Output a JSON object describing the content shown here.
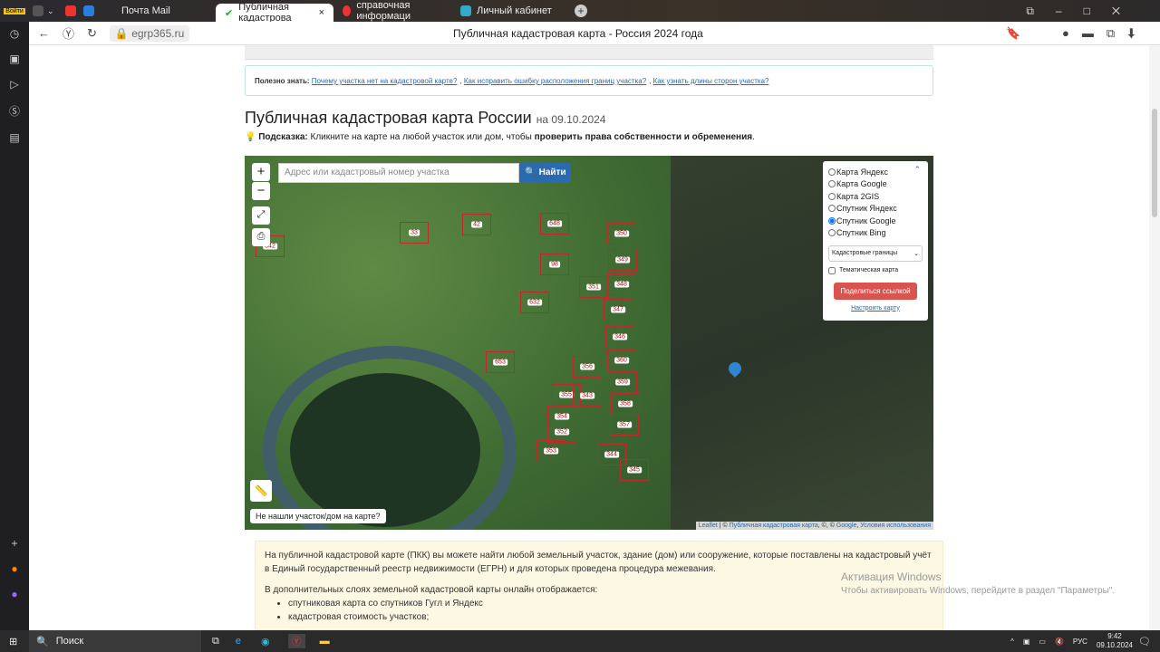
{
  "browser": {
    "login_label": "Войти",
    "tabs": [
      {
        "label": "Почта Mail",
        "active": false
      },
      {
        "label": "Публичная кадастрова",
        "active": true
      },
      {
        "label": "справочная информаци",
        "active": false
      },
      {
        "label": "Личный кабинет",
        "active": false
      }
    ],
    "url": "egrp365.ru",
    "page_title": "Публичная кадастровая карта - Россия 2024 года"
  },
  "hint": {
    "prefix": "Полезно знать:",
    "links": [
      "Почему участка нет на кадастровой карте?",
      "Как исправить ошибку расположения границ участка?",
      "Как узнать длины сторон участка?"
    ]
  },
  "heading": {
    "title": "Публичная кадастровая карта России",
    "date": "на 09.10.2024"
  },
  "tip": {
    "label": "Подсказка:",
    "text": "Кликните на карте на любой участок или дом, чтобы",
    "bold": "проверить права собственности и обременения",
    "end": "."
  },
  "map": {
    "search_placeholder": "Адрес или кадастровый номер участка",
    "find_label": "Найти",
    "layers": [
      {
        "label": "Карта Яндекс",
        "checked": false
      },
      {
        "label": "Карта Google",
        "checked": false
      },
      {
        "label": "Карта 2GIS",
        "checked": false
      },
      {
        "label": "Спутник Яндекс",
        "checked": false
      },
      {
        "label": "Спутник Google",
        "checked": true
      },
      {
        "label": "Спутник Bing",
        "checked": false
      }
    ],
    "overlay_select": "Кадастровые границы",
    "thematic_label": "Тематическая карта",
    "share_label": "Поделиться ссылкой",
    "configure_label": "Настроить карту",
    "not_found_label": "Не нашли участок/дом на карте?",
    "attribution": {
      "leaflet": "Leaflet",
      "pkk": "Публичная кадастровая карта",
      "google": "Google",
      "terms": "Условия использования",
      "sep": " | © ",
      "sep2": ", ©, © "
    },
    "parcels": [
      "648",
      "350",
      "349",
      "348",
      "347",
      "346",
      "360",
      "359",
      "358",
      "357",
      "344",
      "353",
      "354",
      "355",
      "352",
      "632",
      "653",
      "98",
      "33",
      "42",
      "342",
      "356",
      "343",
      "351",
      "345"
    ]
  },
  "info": {
    "p1": "На публичной кадастровой карте (ПКК) вы можете найти любой земельный участок, здание (дом) или сооружение, которые поставлены на кадастровый учёт в Единый государственный реестр недвижимости (ЕГРН) и для которых проведена процедура межевания.",
    "p2": "В дополнительных слоях земельной кадастровой карты онлайн отображается:",
    "items": [
      "спутниковая карта со спутников Гугл и Яндекс",
      "кадастровая стоимость участков;"
    ]
  },
  "watermark": {
    "title": "Активация Windows",
    "text": "Чтобы активировать Windows, перейдите в раздел \"Параметры\"."
  },
  "taskbar": {
    "search": "Поиск",
    "lang": "РУС",
    "time": "9:42",
    "date": "09.10.2024"
  }
}
